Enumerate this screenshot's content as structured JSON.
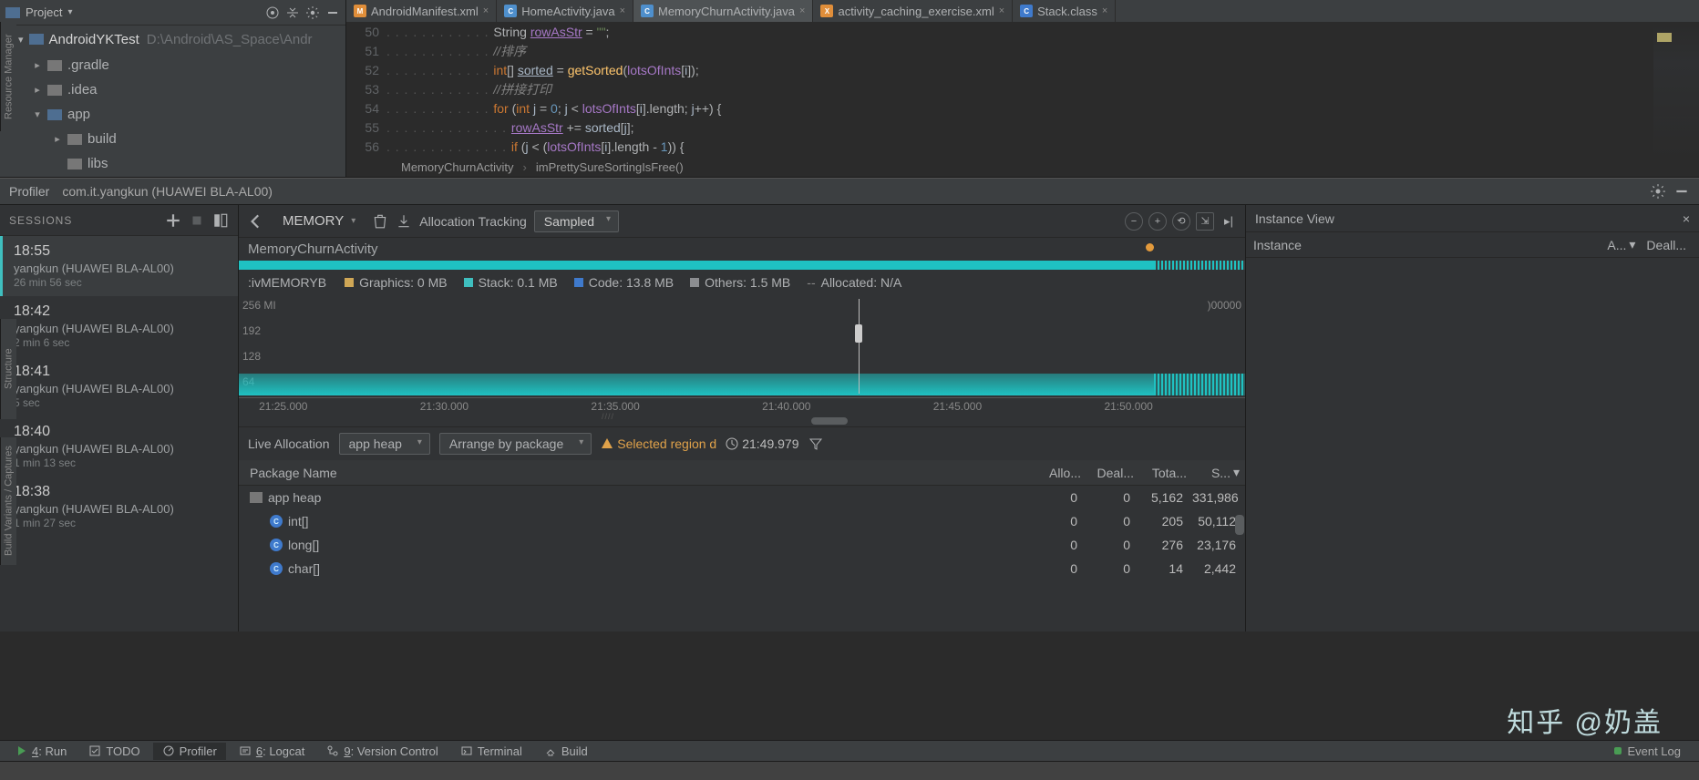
{
  "project_panel": {
    "title": "Project",
    "project_name": "AndroidYKTest",
    "project_path": "D:\\Android\\AS_Space\\Andr",
    "tree": {
      "gradle": ".gradle",
      "idea": ".idea",
      "app": "app",
      "build": "build",
      "libs": "libs"
    }
  },
  "editor": {
    "tabs": [
      {
        "label": "AndroidManifest.xml",
        "type": "xml",
        "active": false
      },
      {
        "label": "HomeActivity.java",
        "type": "java",
        "active": false
      },
      {
        "label": "MemoryChurnActivity.java",
        "type": "java",
        "active": true
      },
      {
        "label": "activity_caching_exercise.xml",
        "type": "xml",
        "active": false
      },
      {
        "label": "Stack.class",
        "type": "class",
        "active": false
      }
    ],
    "gutter": [
      "50",
      "51",
      "52",
      "53",
      "54",
      "55",
      "56"
    ],
    "breadcrumb": {
      "class": "MemoryChurnActivity",
      "method": "imPrettySureSortingIsFree()"
    }
  },
  "profiler": {
    "header_label": "Profiler",
    "device": "com.it.yangkun (HUAWEI BLA-AL00)",
    "sessions_header": "SESSIONS",
    "sessions": [
      {
        "time": "18:55",
        "dev": "yangkun (HUAWEI BLA-AL00)",
        "dur": "26 min 56 sec",
        "active": true
      },
      {
        "time": "18:42",
        "dev": "yangkun (HUAWEI BLA-AL00)",
        "dur": "2 min 6 sec",
        "active": false
      },
      {
        "time": "18:41",
        "dev": "yangkun (HUAWEI BLA-AL00)",
        "dur": "5 sec",
        "active": false
      },
      {
        "time": "18:40",
        "dev": "yangkun (HUAWEI BLA-AL00)",
        "dur": "1 min 13 sec",
        "active": false
      },
      {
        "time": "18:38",
        "dev": "yangkun (HUAWEI BLA-AL00)",
        "dur": "1 min 27 sec",
        "active": false
      }
    ],
    "toolbar": {
      "memory": "MEMORY",
      "alloc_tracking": "Allocation Tracking",
      "sampled": "Sampled"
    },
    "activity_name": "MemoryChurnActivity",
    "legend_left": ":ivMEMORYB",
    "legends": [
      {
        "color": "#cfa756",
        "label": "Graphics: 0 MB"
      },
      {
        "color": "#3fbfbf",
        "label": "Stack: 0.1 MB"
      },
      {
        "color": "#3f7acc",
        "label": "Code: 13.8 MB"
      },
      {
        "color": "#8c8e91",
        "label": "Others: 1.5 MB"
      },
      {
        "color": "",
        "label": "Allocated: N/A",
        "dash": true
      }
    ],
    "yaxis": {
      "t256": "256 MI",
      "t192": "192",
      "t128": "128",
      "t64": "64"
    },
    "y2": ")00000",
    "xaxis": [
      "21:25.000",
      "21:30.000",
      "21:35.000",
      "21:40.000",
      "21:45.000",
      "21:50.000"
    ],
    "bottom_bar": {
      "live": "Live Allocation",
      "heap": "app heap",
      "arrange": "Arrange by package",
      "warn": "Selected region d",
      "timestamp": "21:49.979"
    },
    "table": {
      "header": {
        "name": "Package Name",
        "c1": "Allo...",
        "c2": "Deal...",
        "c3": "Tota...",
        "c4": "S..."
      },
      "rows": [
        {
          "name": "app heap",
          "root": true,
          "c1": "0",
          "c2": "0",
          "c3": "5,162",
          "c4": "331,986"
        },
        {
          "name": "int[]",
          "c1": "0",
          "c2": "0",
          "c3": "205",
          "c4": "50,112"
        },
        {
          "name": "long[]",
          "c1": "0",
          "c2": "0",
          "c3": "276",
          "c4": "23,176"
        },
        {
          "name": "char[]",
          "c1": "0",
          "c2": "0",
          "c3": "14",
          "c4": "2,442"
        }
      ]
    },
    "instance": {
      "title": "Instance View",
      "col1": "Instance",
      "col2": "A...",
      "col3": "Deall..."
    }
  },
  "status_bar": {
    "run": "Run",
    "run_key": "4",
    "todo": "TODO",
    "profiler": "Profiler",
    "logcat": "Logcat",
    "logcat_key": "6",
    "vcs": "Version Control",
    "vcs_key": "9",
    "terminal": "Terminal",
    "build": "Build",
    "event_log": "Event Log"
  },
  "side_tabs": {
    "t1": "Resource Manager",
    "t2": "Structure",
    "t3": "Build Variants / Captures"
  },
  "watermark": "知乎 @奶盖"
}
